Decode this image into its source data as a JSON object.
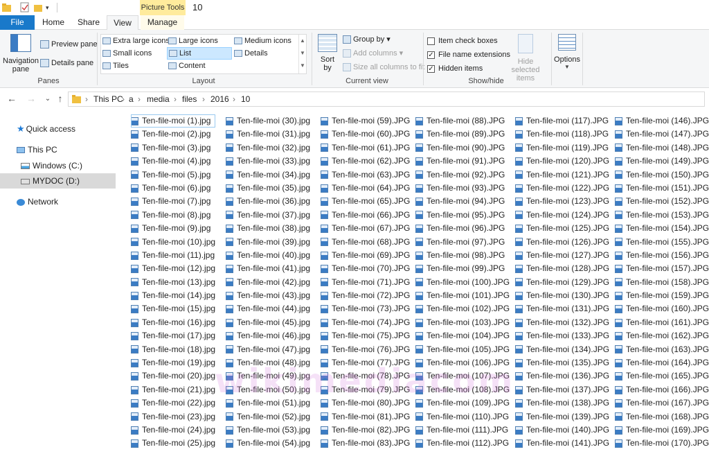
{
  "window": {
    "title": "10"
  },
  "context_tab": {
    "label": "Picture Tools"
  },
  "tabs": [
    {
      "label": "File"
    },
    {
      "label": "Home"
    },
    {
      "label": "Share"
    },
    {
      "label": "View"
    },
    {
      "label": "Manage"
    }
  ],
  "ribbon": {
    "panes": {
      "navigation_pane": "Navigation\npane",
      "preview_pane": "Preview pane",
      "details_pane": "Details pane",
      "label": "Panes"
    },
    "layout": {
      "items": [
        "Extra large icons",
        "Large icons",
        "Medium icons",
        "Small icons",
        "List",
        "Details",
        "Tiles",
        "Content"
      ],
      "selected": "List",
      "label": "Layout"
    },
    "current_view": {
      "sort_by": "Sort\nby",
      "group_by": "Group by",
      "add_columns": "Add columns",
      "size_columns": "Size all columns to fit",
      "label": "Current view"
    },
    "show_hide": {
      "item_check_boxes": {
        "label": "Item check boxes",
        "checked": false
      },
      "file_name_extensions": {
        "label": "File name extensions",
        "checked": true
      },
      "hidden_items": {
        "label": "Hidden items",
        "checked": true
      },
      "hide_selected": "Hide selected\nitems",
      "label": "Show/hide"
    },
    "options": {
      "label": "Options"
    }
  },
  "address_bar": {
    "crumbs": [
      "This PC",
      "a",
      "media",
      "files",
      "2016",
      "10"
    ]
  },
  "sidebar": {
    "items": [
      {
        "label": "Quick access",
        "icon": "star-icon"
      },
      {
        "label": "This PC",
        "icon": "computer-icon"
      },
      {
        "label": "Windows (C:)",
        "icon": "drive-icon"
      },
      {
        "label": "MYDOC (D:)",
        "icon": "drive-icon",
        "selected": true
      },
      {
        "label": "Network",
        "icon": "network-icon"
      }
    ]
  },
  "files": {
    "prefix": "Ten-file-moi",
    "columns": [
      {
        "start": 1,
        "end": 25,
        "ext": ".jpg"
      },
      {
        "start": 30,
        "end": 54,
        "ext": ".jpg"
      },
      {
        "start": 59,
        "end": 83,
        "ext": ".JPG"
      },
      {
        "start": 88,
        "end": 112,
        "ext": ".JPG"
      },
      {
        "start": 117,
        "end": 141,
        "ext": ".JPG"
      },
      {
        "start": 146,
        "end": 170,
        "ext": ".JPG"
      }
    ]
  },
  "watermark": {
    "text": "wikimediacom"
  },
  "colors": {
    "accent": "#1979ca",
    "context_tab": "#ffeb9c",
    "selection": "#cce8ff"
  }
}
